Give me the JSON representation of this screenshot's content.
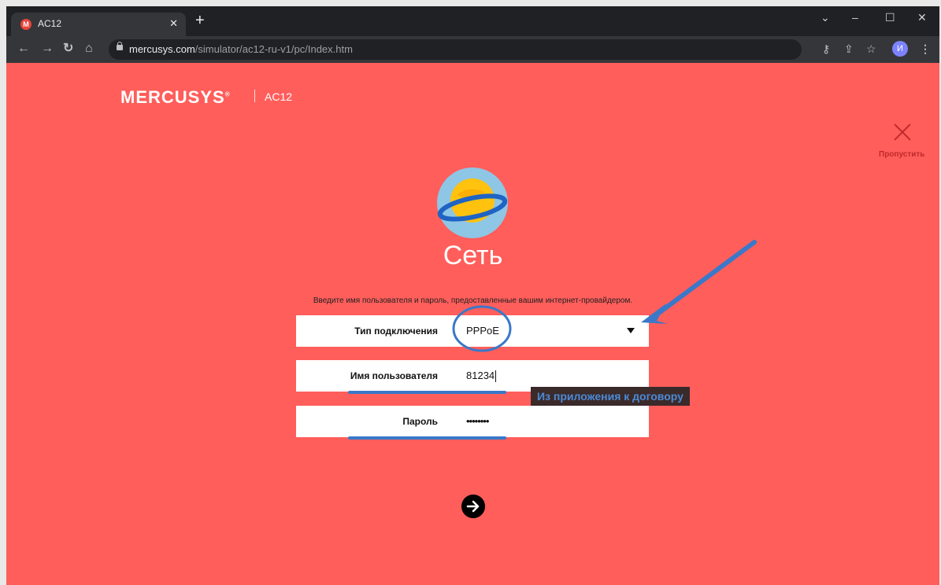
{
  "browser": {
    "tab_title": "AC12",
    "tab_favicon_letter": "M",
    "url_host": "mercusys.com",
    "url_path": "/simulator/ac12-ru-v1/pc/Index.htm",
    "profile_initial": "И"
  },
  "header": {
    "brand": "MERCUSYS",
    "brand_mark": "®",
    "model": "AC12"
  },
  "skip": {
    "label": "Пропустить"
  },
  "main": {
    "title": "Сеть",
    "instruction": "Введите имя пользователя и пароль, предоставленные вашим интернет-провайдером.",
    "fields": {
      "connection_type": {
        "label": "Тип подключения",
        "value": "PPPoE"
      },
      "username": {
        "label": "Имя пользователя",
        "value": "81234"
      },
      "password": {
        "label": "Пароль",
        "value": "••••••••"
      }
    },
    "tooltip": "Из приложения к договору"
  },
  "colors": {
    "page_bg": "#ff5e5b",
    "annotation_blue": "#3a78c9",
    "skip_red": "#c0292b"
  }
}
